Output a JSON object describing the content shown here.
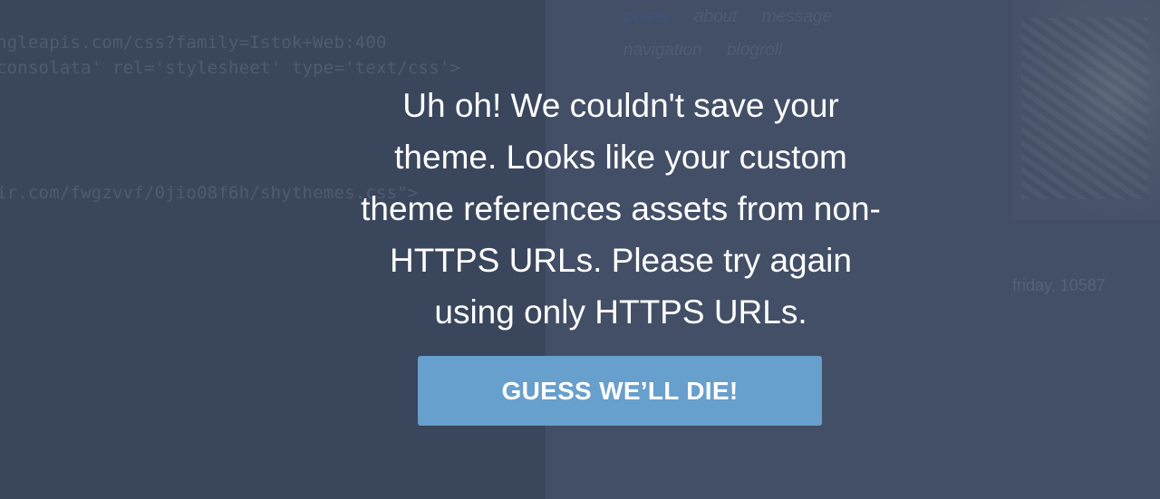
{
  "editor": {
    "code_lines": [
      "ngleapis.com/css?family=Istok+Web:400",
      "consolata' rel='stylesheet' type='text/css'>",
      "ir.com/fwgzvvf/0jio08f6h/shythemes.css\">"
    ]
  },
  "preview": {
    "nav_row1": [
      "posts",
      "about",
      "message"
    ],
    "nav_row2": [
      "navigation",
      "blogroll"
    ],
    "date_text": "friday, 10587"
  },
  "dialog": {
    "message": "Uh oh! We couldn't save your theme. Looks like your custom theme references assets from non-HTTPS URLs. Please try again using only HTTPS URLs.",
    "button_label": "GUESS WE’LL DIE!"
  },
  "colors": {
    "overlay_background": "#3d4a60",
    "button_background": "#679fcd",
    "message_text": "#ffffff"
  }
}
